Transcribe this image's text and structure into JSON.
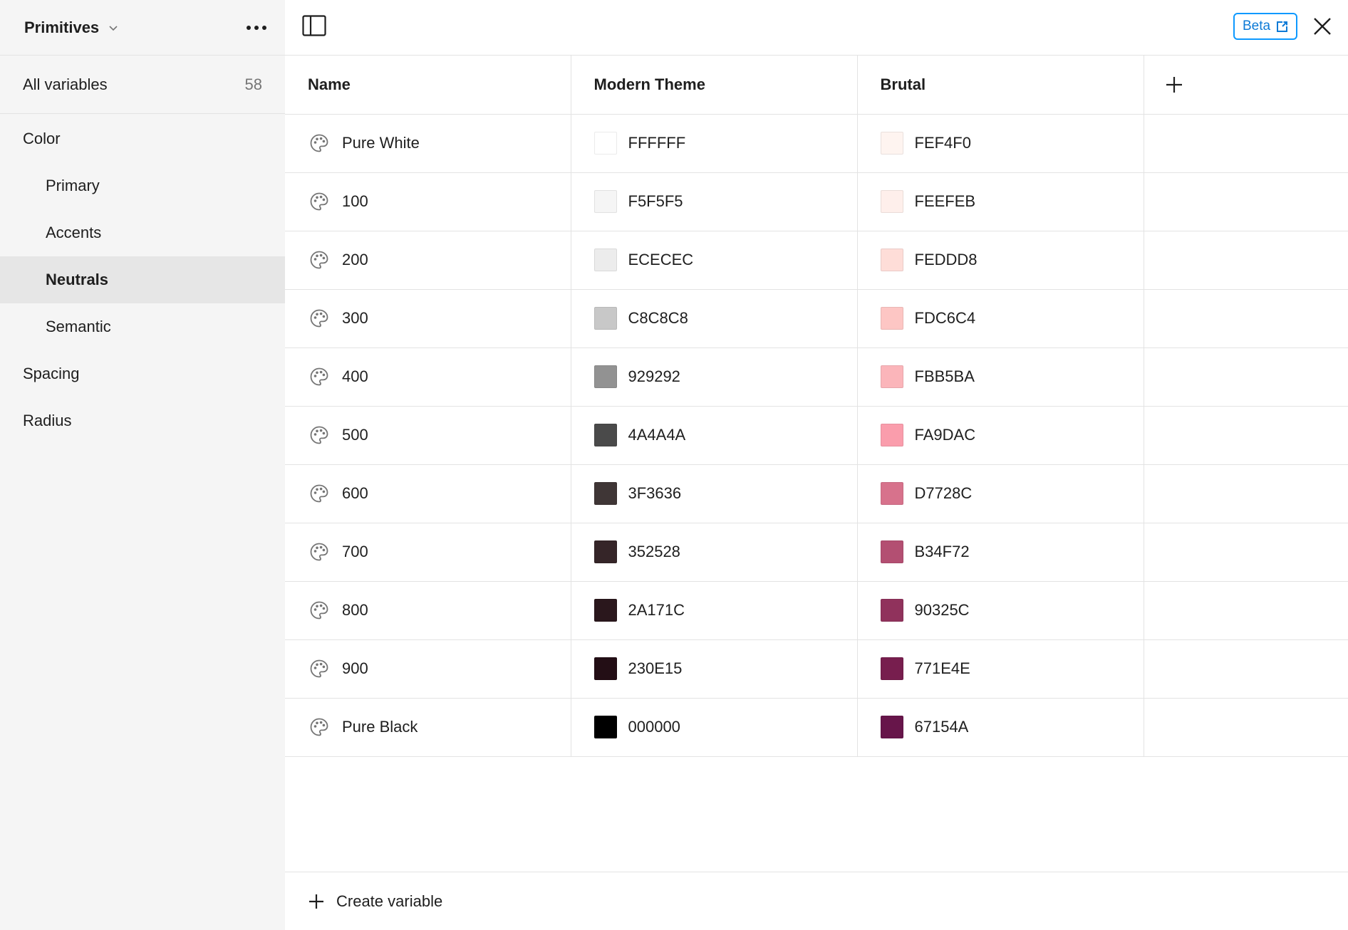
{
  "sidebar": {
    "collection": "Primitives",
    "all_label": "All variables",
    "all_count": "58",
    "groups": [
      {
        "label": "Color",
        "level": 0,
        "active": false
      },
      {
        "label": "Primary",
        "level": 1,
        "active": false
      },
      {
        "label": "Accents",
        "level": 1,
        "active": false
      },
      {
        "label": "Neutrals",
        "level": 1,
        "active": true
      },
      {
        "label": "Semantic",
        "level": 1,
        "active": false
      },
      {
        "label": "Spacing",
        "level": 0,
        "active": false
      },
      {
        "label": "Radius",
        "level": 0,
        "active": false
      }
    ]
  },
  "topbar": {
    "beta_label": "Beta"
  },
  "table": {
    "headers": [
      "Name",
      "Modern Theme",
      "Brutal"
    ],
    "rows": [
      {
        "name": "Pure White",
        "modern": "FFFFFF",
        "brutal": "FEF4F0"
      },
      {
        "name": "100",
        "modern": "F5F5F5",
        "brutal": "FEEFEB"
      },
      {
        "name": "200",
        "modern": "ECECEC",
        "brutal": "FEDDD8"
      },
      {
        "name": "300",
        "modern": "C8C8C8",
        "brutal": "FDC6C4"
      },
      {
        "name": "400",
        "modern": "929292",
        "brutal": "FBB5BA"
      },
      {
        "name": "500",
        "modern": "4A4A4A",
        "brutal": "FA9DAC"
      },
      {
        "name": "600",
        "modern": "3F3636",
        "brutal": "D7728C"
      },
      {
        "name": "700",
        "modern": "352528",
        "brutal": "B34F72"
      },
      {
        "name": "800",
        "modern": "2A171C",
        "brutal": "90325C"
      },
      {
        "name": "900",
        "modern": "230E15",
        "brutal": "771E4E"
      },
      {
        "name": "Pure Black",
        "modern": "000000",
        "brutal": "67154A"
      }
    ]
  },
  "footer": {
    "create_label": "Create variable"
  }
}
